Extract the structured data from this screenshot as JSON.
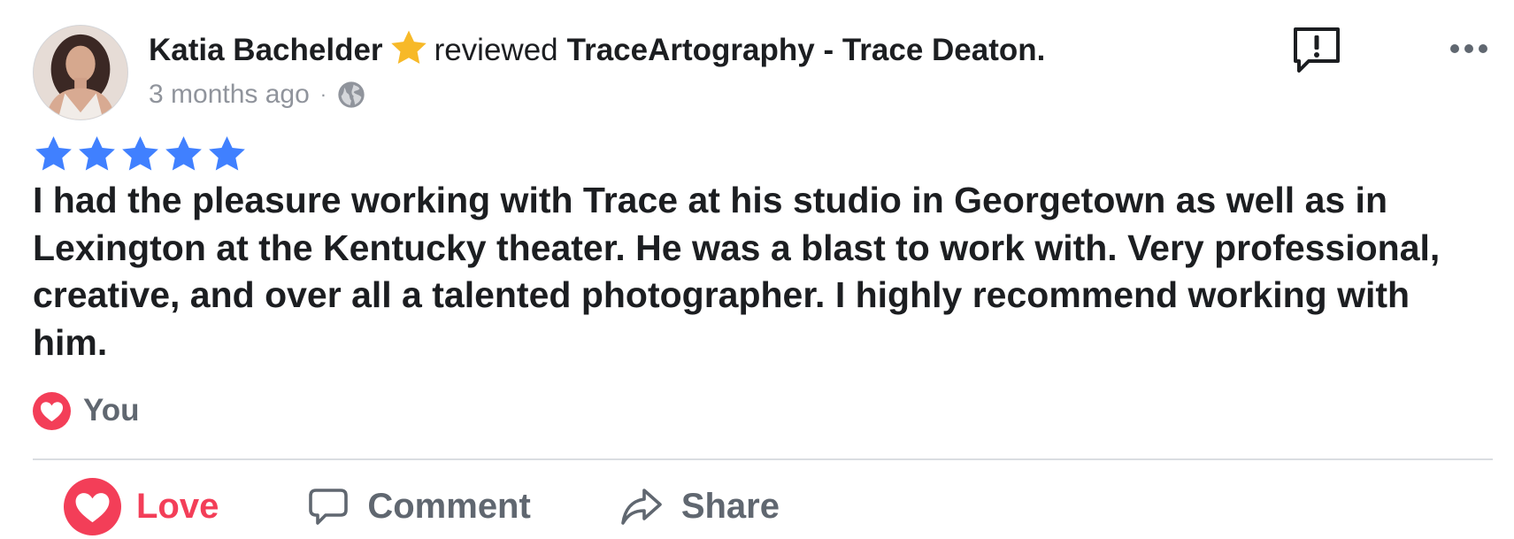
{
  "review": {
    "author": "Katia Bachelder",
    "verb": "reviewed",
    "page_name": "TraceArtography - Trace Deaton.",
    "timestamp": "3 months ago",
    "separator": "·",
    "privacy_icon": "globe-icon",
    "rating_stars": 5,
    "text": "I had the pleasure working with Trace at his studio in Georgetown as well as in Lexington at the Kentucky theater. He was a blast to work with. Very professional, creative, and over all a talented photographer. I highly recommend working with him."
  },
  "reactions": {
    "icon": "heart-reaction-icon",
    "label": "You"
  },
  "actions": {
    "love_label": "Love",
    "comment_label": "Comment",
    "share_label": "Share"
  },
  "colors": {
    "star_rating": "#4080ff",
    "badge_star": "#f7b928",
    "love": "#f33e58",
    "secondary_text": "#90949c",
    "action_text": "#606770"
  }
}
